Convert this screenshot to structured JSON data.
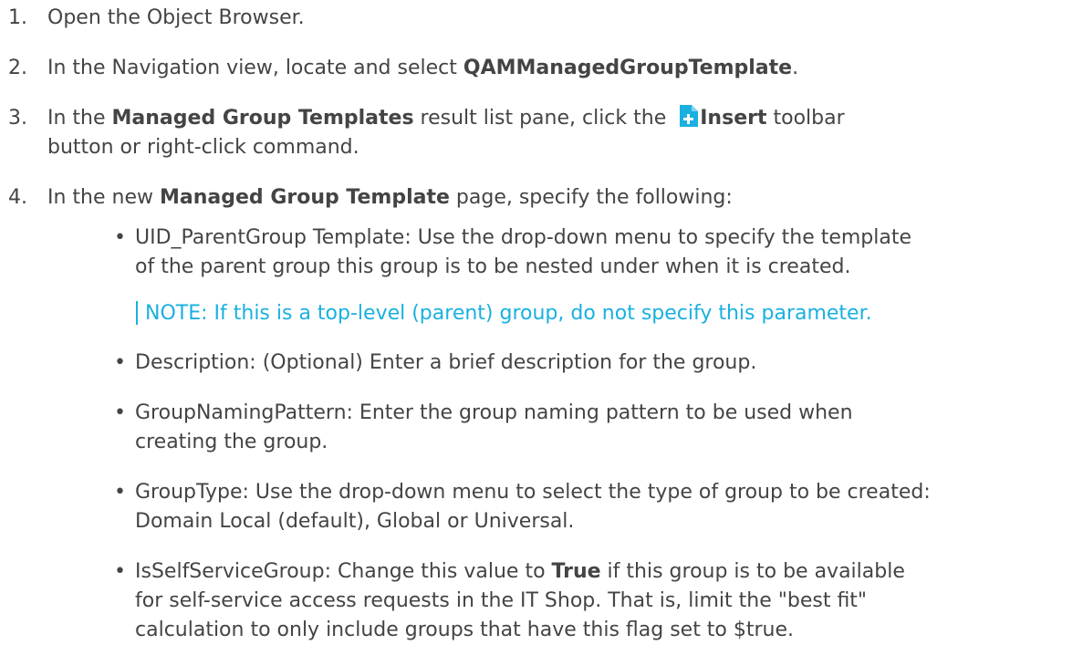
{
  "steps": [
    {
      "num": "1.",
      "text": "Open the Object Browser."
    },
    {
      "num": "2.",
      "pre": "In the Navigation view, locate and select ",
      "bold": "QAMManagedGroupTemplate",
      "post": "."
    },
    {
      "num": "3.",
      "pre": "In the ",
      "bold": "Managed Group Templates",
      "mid": " result list pane, click the ",
      "bold2": "Insert",
      "post": " toolbar",
      "line2": "button or right-click command."
    },
    {
      "num": "4.",
      "pre": "In the new ",
      "bold": "Managed Group Template",
      "post": " page, specify the following:"
    }
  ],
  "bullets": [
    {
      "line1": "UID_ParentGroup Template: Use the drop-down menu to specify the template",
      "line2": "of the parent group this group is to be nested under when it is created."
    },
    {
      "line1": "Description: (Optional) Enter a brief description for the group."
    },
    {
      "line1": "GroupNamingPattern: Enter the group naming pattern to be used when",
      "line2": "creating the group."
    },
    {
      "line1": "GroupType: Use the drop-down menu to select the type of group to be created:",
      "line2": "Domain Local (default), Global or Universal."
    },
    {
      "pre": "IsSelfServiceGroup: Change this value to ",
      "bold": "True",
      "post": " if this group is to be available",
      "line2": "for self-service access requests in the IT Shop. That is, limit the \"best fit\"",
      "line3": "calculation to only include groups that have this flag set to $true."
    }
  ],
  "note": {
    "label": "NOTE:",
    "text": " If this is a top-level (parent) group, do not specify this parameter."
  },
  "icons": {
    "insert_icon": "insert-icon",
    "insert_color": "#1ab0e0"
  },
  "bullet_glyph": "•"
}
